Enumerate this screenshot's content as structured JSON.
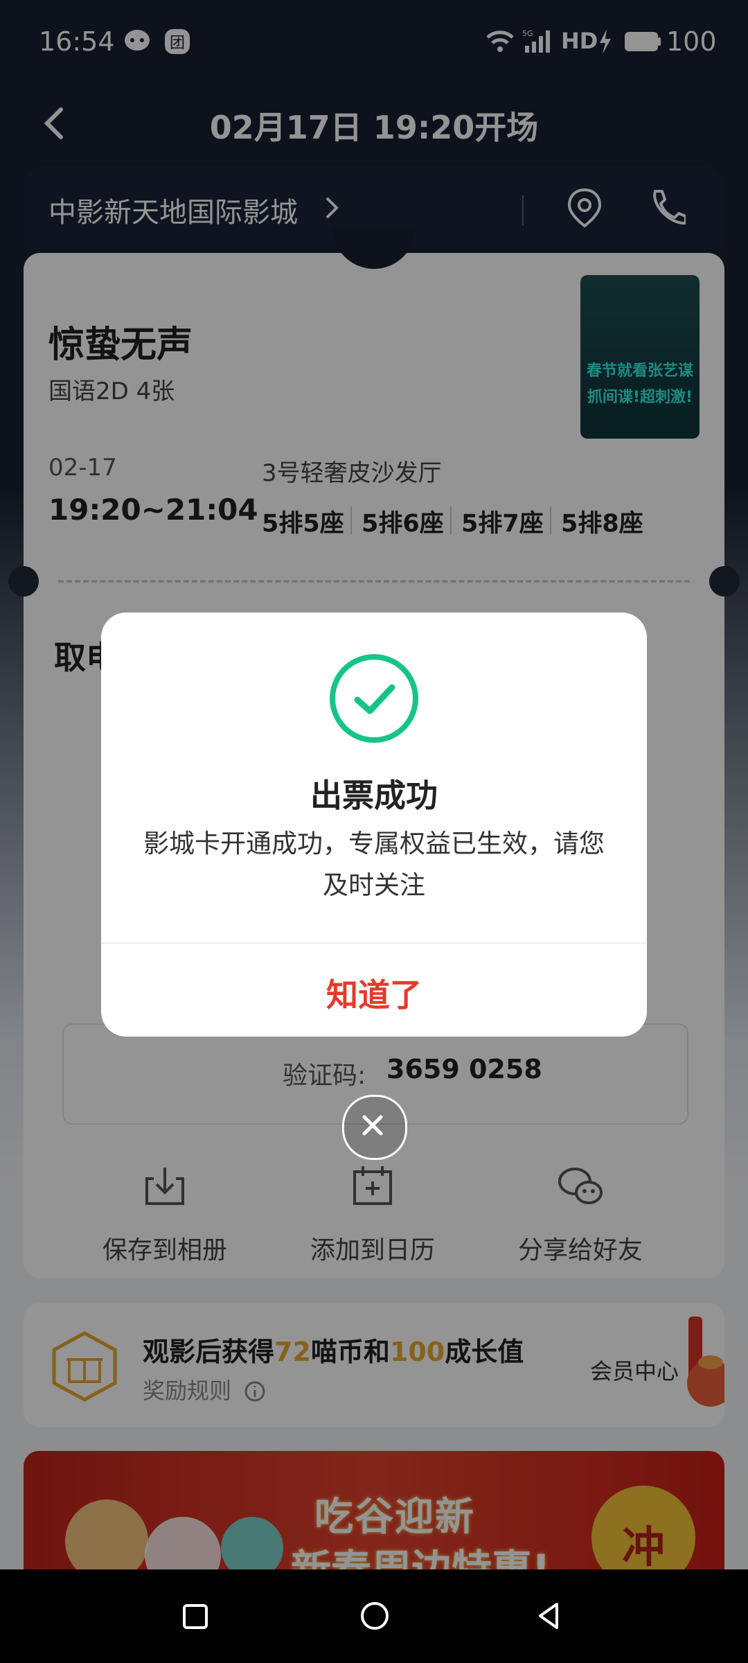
{
  "status_bar": {
    "time": "16:54",
    "network": "5G",
    "hd": "HD",
    "battery": "100"
  },
  "header": {
    "title": "02月17日 19:20开场"
  },
  "cinema": {
    "name": "中影新天地国际影城"
  },
  "ticket": {
    "movie_title": "惊蛰无声",
    "version": "国语2D 4张",
    "poster_text": [
      "春节就看张艺谋",
      "抓间谍!超刺激!"
    ],
    "date": "02-17",
    "time_range": "19:20~21:04",
    "hall": "3号轻奢皮沙发厅",
    "seats": [
      "5排5座",
      "5排6座",
      "5排7座",
      "5排8座"
    ],
    "pickup_title_partial": "取电",
    "verify_label": "验证码:",
    "verify_code": "3659 0258"
  },
  "actions": [
    {
      "label": "保存到相册",
      "icon": "download-icon"
    },
    {
      "label": "添加到日历",
      "icon": "calendar-add-icon"
    },
    {
      "label": "分享给好友",
      "icon": "wechat-icon"
    }
  ],
  "reward": {
    "text_prefix": "观影后获得",
    "coins": "72",
    "text_mid": "喵币和",
    "growth": "100",
    "text_suffix": "成长值",
    "rules": "奖励规则",
    "member": "会员中心"
  },
  "banner": {
    "line1": "吃谷迎新",
    "line2": "新春周边特惠!",
    "coin_text": "冲"
  },
  "modal": {
    "title": "出票成功",
    "message": "影城卡开通成功，专属权益已生效，请您及时关注",
    "confirm": "知道了"
  },
  "colors": {
    "accent_red": "#e8382a",
    "success_green": "#16c48a",
    "highlight_orange": "#e8a830"
  }
}
